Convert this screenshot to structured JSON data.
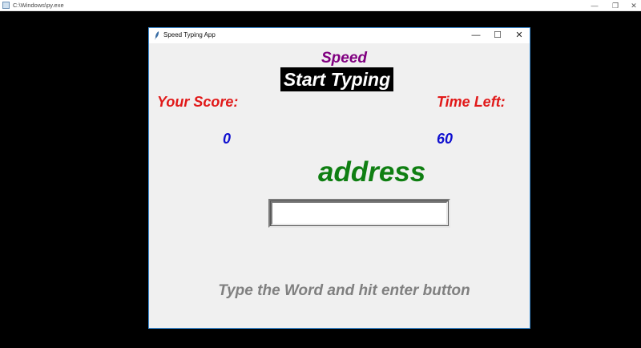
{
  "console": {
    "title": "C:\\Windows\\py.exe",
    "controls": {
      "minimize": "—",
      "restore": "❐",
      "close": "✕"
    }
  },
  "app": {
    "title": "Speed Typing App",
    "controls": {
      "minimize": "—",
      "maximize": "☐",
      "close": "✕"
    },
    "speed_label": "Speed",
    "start_button_label": "Start Typing",
    "score_label": "Your Score:",
    "time_label": "Time Left:",
    "score_value": "0",
    "time_value": "60",
    "current_word": "address",
    "entry": {
      "value": ""
    },
    "hint": "Type the Word and hit enter button"
  },
  "colors": {
    "speed_label": "#800080",
    "labels": "#e11a1a",
    "values": "#1010d0",
    "word": "#0f7f12",
    "hint": "#808080",
    "window_border": "#3b8fd9"
  }
}
